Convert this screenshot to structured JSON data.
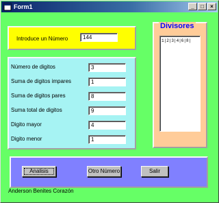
{
  "window": {
    "title": "Form1",
    "controls": {
      "minimize": "_",
      "maximize": "□",
      "close": "×"
    }
  },
  "number_panel": {
    "label": "Introduce un Número",
    "value": "144"
  },
  "stats": [
    {
      "label": "Número de digitos",
      "value": "3"
    },
    {
      "label": "Suma de digitos impares",
      "value": "1"
    },
    {
      "label": "Suma de digitos pares",
      "value": "8"
    },
    {
      "label": "Suma total de digitos",
      "value": "9"
    },
    {
      "label": "Digito mayor",
      "value": "4"
    },
    {
      "label": "Digito menor",
      "value": "1"
    }
  ],
  "divisores": {
    "title": "Divisores",
    "list_text": "1|2|3|4|6|8|"
  },
  "buttons": {
    "analysis": "Analisis",
    "other": "Otro Número",
    "exit": "Salir"
  },
  "footer": "Anderson Benites Corazón",
  "colors": {
    "client": "#66ff66",
    "yellow_panel": "#ffff00",
    "cyan_panel": "#a6f3f3",
    "orange_panel": "#ffcc99",
    "blue_panel": "#8080ff",
    "divisores_title": "#0000ff"
  }
}
